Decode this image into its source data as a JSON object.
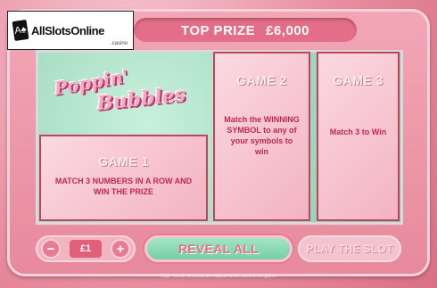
{
  "logo": {
    "card": "A♠",
    "text": "AllSlotsOnline",
    "sub": ".casino"
  },
  "top_prize": {
    "label": "TOP PRIZE",
    "amount": "£6,000"
  },
  "brand": {
    "line1": "Poppin'",
    "line2": "Bubbles"
  },
  "games": [
    {
      "title": "GAME 1",
      "desc": "MATCH 3 NUMBERS IN A ROW AND WIN THE PRIZE"
    },
    {
      "title": "GAME 2",
      "desc": "Match the WINNING SYMBOL to any of your symbols to win"
    },
    {
      "title": "GAME 3",
      "desc": "Match 3 to Win"
    }
  ],
  "controls": {
    "minus": "−",
    "plus": "+",
    "stake": "£1",
    "reveal_all": "REVEAL ALL",
    "play_the_slot": "PLAY THE SLOT"
  },
  "footnote": "Help. Terms. All prizes are subject to the rules of the game."
}
